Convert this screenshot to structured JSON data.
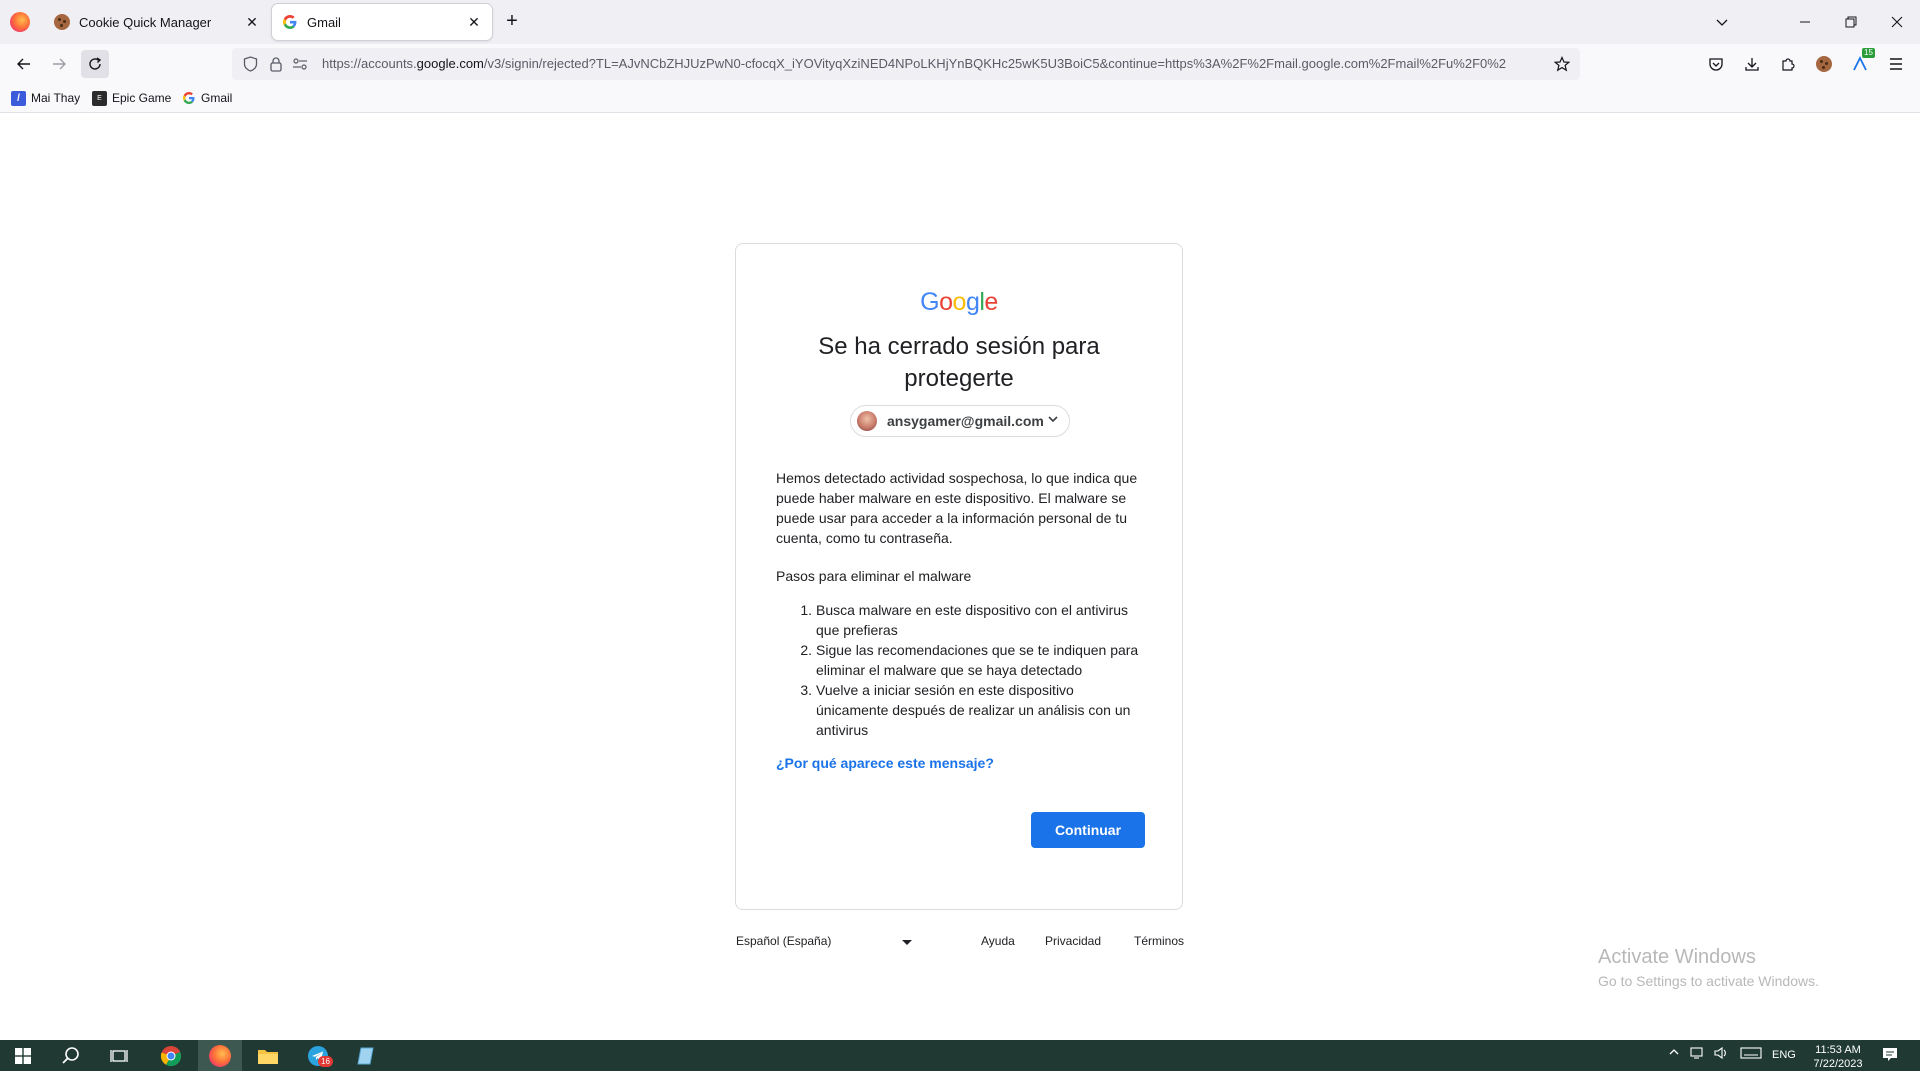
{
  "browser": {
    "tabs": [
      {
        "label": "Cookie Quick Manager",
        "active": false
      },
      {
        "label": "Gmail",
        "active": true
      }
    ],
    "url_prefix": "https://accounts.",
    "url_domain": "google.com",
    "url_rest": "/v3/signin/rejected?TL=AJvNCbZHJUzPwN0-cfocqX_iYOVityqXziNED4NPoLKHjYnBQKHc25wK5U3BoiC5&continue=https%3A%2F%2Fmail.google.com%2Fmail%2Fu%2F0%2",
    "extension_badge": "15",
    "bookmarks": [
      {
        "label": "Mai Thay"
      },
      {
        "label": "Epic Game"
      },
      {
        "label": "Gmail"
      }
    ]
  },
  "card": {
    "logo": [
      "G",
      "o",
      "o",
      "g",
      "l",
      "e"
    ],
    "logo_colors": [
      "#4285F4",
      "#EA4335",
      "#FBBC05",
      "#4285F4",
      "#34A853",
      "#EA4335"
    ],
    "heading": "Se ha cerrado sesión para protegerte",
    "account_email": "ansygamer@gmail.com",
    "body": "Hemos detectado actividad sospechosa, lo que indica que puede haber malware en este dispositivo. El malware se puede usar para acceder a la información personal de tu cuenta, como tu contraseña.",
    "steps_title": "Pasos para eliminar el malware",
    "steps": [
      {
        "num": "1.",
        "text": "Busca malware en este dispositivo con el antivirus que prefieras"
      },
      {
        "num": "2.",
        "text": "Sigue las recomendaciones que se te indiquen para eliminar el malware que se haya detectado"
      },
      {
        "num": "3.",
        "text": "Vuelve a iniciar sesión en este dispositivo únicamente después de realizar un análisis con un antivirus"
      }
    ],
    "help_link": "¿Por qué aparece este mensaje?",
    "continue_label": "Continuar"
  },
  "footer": {
    "language": "Español (España)",
    "links": [
      "Ayuda",
      "Privacidad",
      "Términos"
    ]
  },
  "watermark": {
    "title": "Activate Windows",
    "subtitle": "Go to Settings to activate Windows."
  },
  "taskbar": {
    "telegram_badge": "16",
    "lang": "ENG",
    "time": "11:53 AM",
    "date": "7/22/2023"
  },
  "colors": {
    "accent": "#1a73e8",
    "taskbar": "#203a33"
  }
}
